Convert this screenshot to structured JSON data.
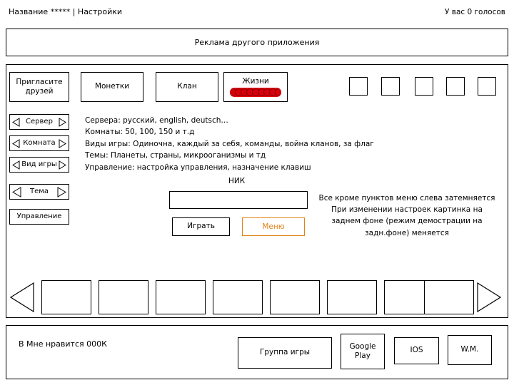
{
  "header": {
    "title_prefix": "Название",
    "title_stars": "*****",
    "title_separator": "|",
    "title_settings": "Настройки",
    "votes": "У вас 0 голосов"
  },
  "ad": {
    "label": "Реклама другого приложения"
  },
  "top_buttons": [
    {
      "name": "invite-friends",
      "label": "Пригласите друзей"
    },
    {
      "name": "coins",
      "label": "Монетки"
    },
    {
      "name": "clan",
      "label": "Клан"
    }
  ],
  "lives": {
    "label": "Жизни",
    "pip_count": 9,
    "bar_color": "#e8000d"
  },
  "placeholder_squares": {
    "count": 5
  },
  "steppers": [
    {
      "name": "server",
      "label": "Сервер"
    },
    {
      "name": "room",
      "label": "Комната"
    },
    {
      "name": "game-mode",
      "label": "Вид игры"
    },
    {
      "name": "theme",
      "label": "Тема"
    }
  ],
  "controls_button": {
    "label": "Управление"
  },
  "description": {
    "lines": [
      "Сервера: русский, english, deutsch…",
      "Комнаты: 50, 100, 150 и т.д",
      "Виды игры: Одиночна, каждый за себя, команды, война кланов, за флаг",
      "Темы: Планеты, страны, микрооганизмы и тд",
      "Управление: настройка управления, назначение клавиш"
    ]
  },
  "nick": {
    "label": "НИК",
    "value": "",
    "placeholder": ""
  },
  "actions": {
    "play_label": "Играть",
    "menu_label": "Меню",
    "menu_color": "#E08214"
  },
  "annotation": {
    "lines": [
      "Все кроме пунктов меню слева затемняется",
      "При изменении настроек картинка на",
      "заднем фоне (режим демострации на",
      "задн.фоне) меняется"
    ]
  },
  "carousel": {
    "prev_icon": "triangle-left-icon",
    "next_icon": "triangle-right-icon",
    "item_count": 8
  },
  "footer": {
    "like_text": "В  Мне нравится  000К",
    "buttons": [
      {
        "name": "game-group",
        "label": "Группа игры"
      },
      {
        "name": "google-play",
        "label": "Google Play"
      },
      {
        "name": "ios",
        "label": "IOS"
      },
      {
        "name": "wm",
        "label": "W.M."
      }
    ]
  }
}
